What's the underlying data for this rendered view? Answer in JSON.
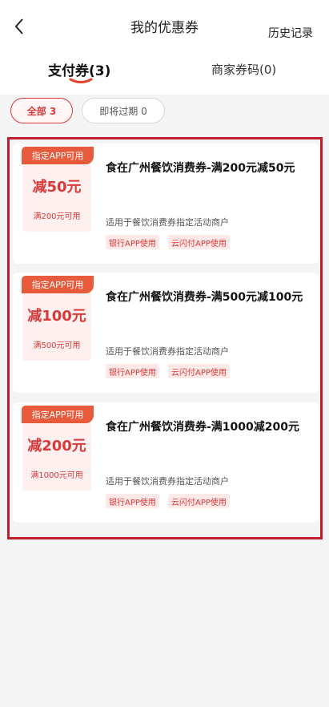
{
  "header": {
    "title": "我的优惠券",
    "history_label": "历史记录"
  },
  "tabs": {
    "pay": "支付券(3)",
    "merchant": "商家券码(0)"
  },
  "filters": {
    "all": "全部 3",
    "expiring": "即将过期 0"
  },
  "coupons": [
    {
      "tag": "指定APP可用",
      "discount": "减50元",
      "threshold": "满200元可用",
      "title": "食在广州餐饮消费券-满200元减50元",
      "description": "适用于餐饮消费券指定活动商户",
      "badges": [
        "银行APP使用",
        "云闪付APP使用"
      ]
    },
    {
      "tag": "指定APP可用",
      "discount": "减100元",
      "threshold": "满500元可用",
      "title": "食在广州餐饮消费券-满500元减100元",
      "description": "适用于餐饮消费券指定活动商户",
      "badges": [
        "银行APP使用",
        "云闪付APP使用"
      ]
    },
    {
      "tag": "指定APP可用",
      "discount": "减200元",
      "threshold": "满1000元可用",
      "title": "食在广州餐饮消费券-满1000减200元",
      "description": "适用于餐饮消费券指定活动商户",
      "badges": [
        "银行APP使用",
        "云闪付APP使用"
      ]
    }
  ],
  "colors": {
    "accent": "#d9393a",
    "tag": "#e85a3c",
    "frame": "#c41e2e"
  }
}
